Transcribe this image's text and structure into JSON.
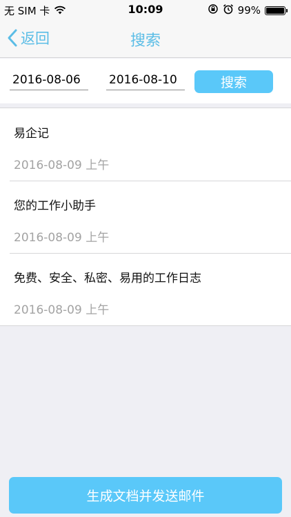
{
  "status_bar": {
    "carrier": "无 SIM 卡",
    "time": "10:09",
    "battery": "99%",
    "battery_level": 0.99,
    "icons": [
      "wifi-icon",
      "rotation-lock-icon",
      "alarm-icon",
      "battery-icon"
    ]
  },
  "nav": {
    "back_label": "返回",
    "title": "搜索"
  },
  "search": {
    "start_date": "2016-08-06",
    "end_date": "2016-08-10",
    "button_label": "搜索"
  },
  "results": [
    {
      "title": "易企记",
      "date": "2016-08-09 上午"
    },
    {
      "title": "您的工作小助手",
      "date": "2016-08-09 上午"
    },
    {
      "title": "免费、安全、私密、易用的工作日志",
      "date": "2016-08-09 上午"
    }
  ],
  "bottom": {
    "button_label": "生成文档并发送邮件"
  },
  "colors": {
    "accent": "#5ac8f9",
    "nav_text": "#5bbde6",
    "background": "#efeff4",
    "muted_text": "#a3a3a3"
  }
}
